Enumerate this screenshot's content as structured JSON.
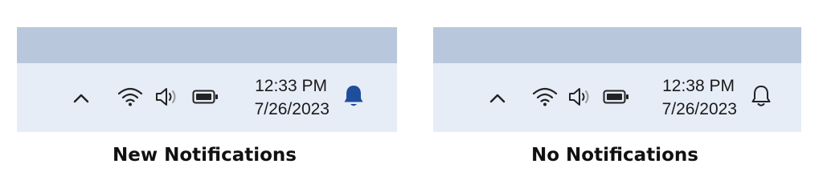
{
  "panels": [
    {
      "clock": {
        "time": "12:33 PM",
        "date": "7/26/2023"
      },
      "icons": [
        "chevron-up-icon",
        "wifi-icon",
        "volume-icon",
        "battery-icon",
        "bell-filled-icon"
      ],
      "bell_color": "#1f4e9c",
      "caption": "New Notifications"
    },
    {
      "clock": {
        "time": "12:38 PM",
        "date": "7/26/2023"
      },
      "icons": [
        "chevron-up-icon",
        "wifi-icon",
        "volume-icon",
        "battery-icon",
        "bell-outline-icon"
      ],
      "bell_color": "#222222",
      "caption": "No Notifications"
    }
  ],
  "colors": {
    "desktop": "#b8c7dc",
    "taskbar": "#e6edf7",
    "icon": "#222222",
    "accent": "#1f4e9c"
  }
}
